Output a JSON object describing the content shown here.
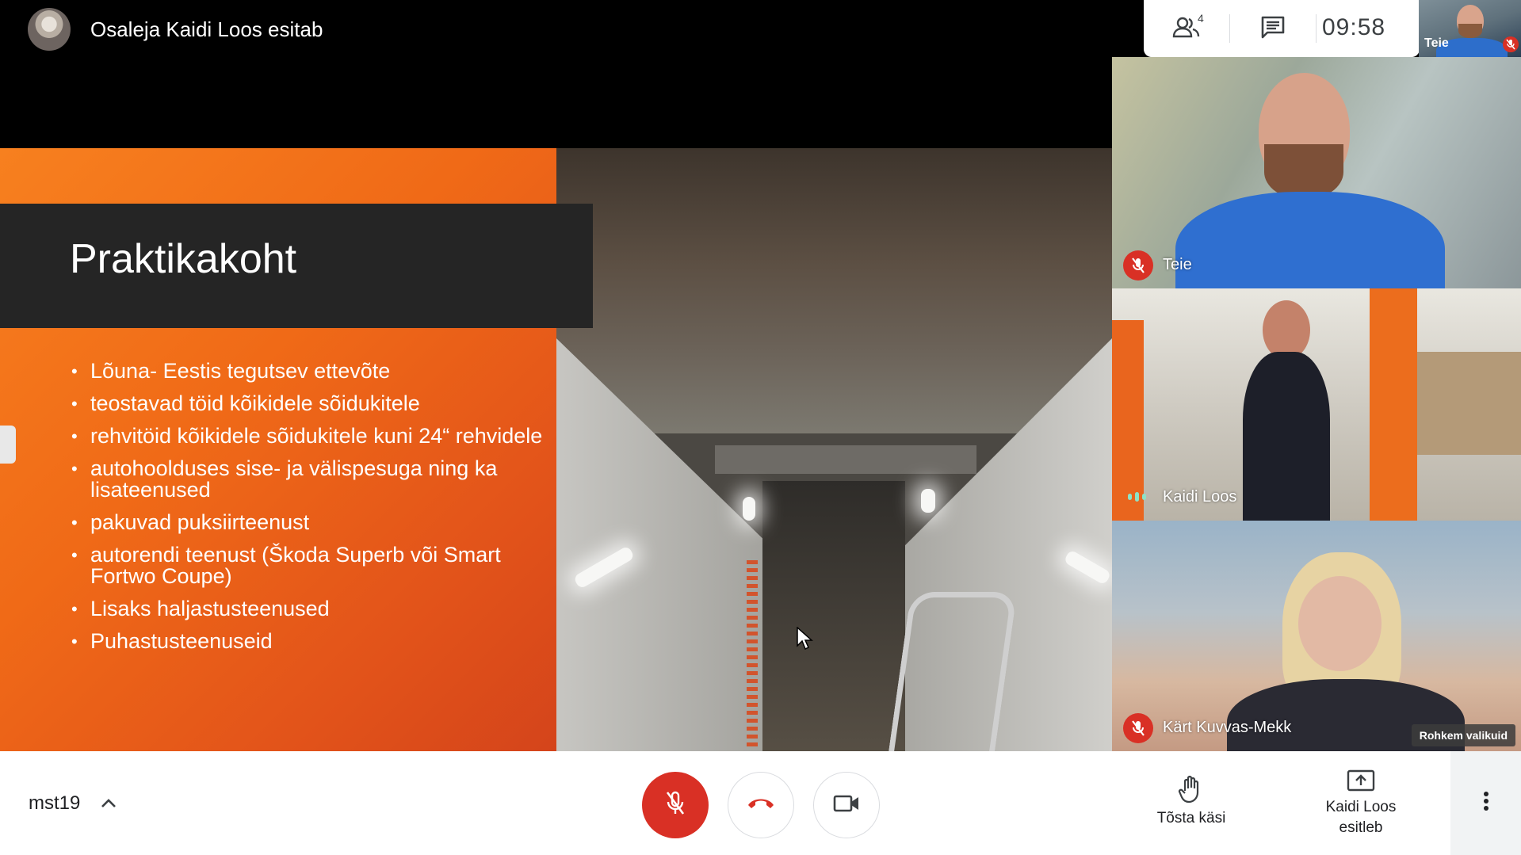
{
  "header": {
    "presenter_text": "Osaleja Kaidi Loos esitab",
    "participant_count": "4",
    "clock": "09:58",
    "self_label": "Teie"
  },
  "slide": {
    "title": "Praktikakoht",
    "bullets": [
      "Lõuna- Eestis tegutsev ettevõte",
      " teostavad  töid kõikidele sõidukitele",
      " rehvitöid kõikidele sõidukitele kuni 24“ rehvidele",
      " autohoolduses sise- ja välispesuga ning ka lisateenused",
      "pakuvad puksiirteenust",
      " autorendi teenust (Škoda Superb või Smart Fortwo Coupe)",
      "Lisaks haljastusteenused",
      "Puhastusteenuseid"
    ]
  },
  "tiles": [
    {
      "name": "Teie",
      "status": "muted"
    },
    {
      "name": "Kaidi Loos",
      "status": "speaking"
    },
    {
      "name": "Kärt Kuvvas-Mekk",
      "status": "muted"
    }
  ],
  "more_options_label": "Rohkem valikuid",
  "bottombar": {
    "meeting_code": "mst19",
    "raise_hand_label": "Tõsta käsi",
    "presenting_line1": "Kaidi Loos",
    "presenting_line2": "esitleb"
  },
  "colors": {
    "accent_red": "#d93025",
    "slide_orange": "#f06a17",
    "title_band": "#252525"
  }
}
